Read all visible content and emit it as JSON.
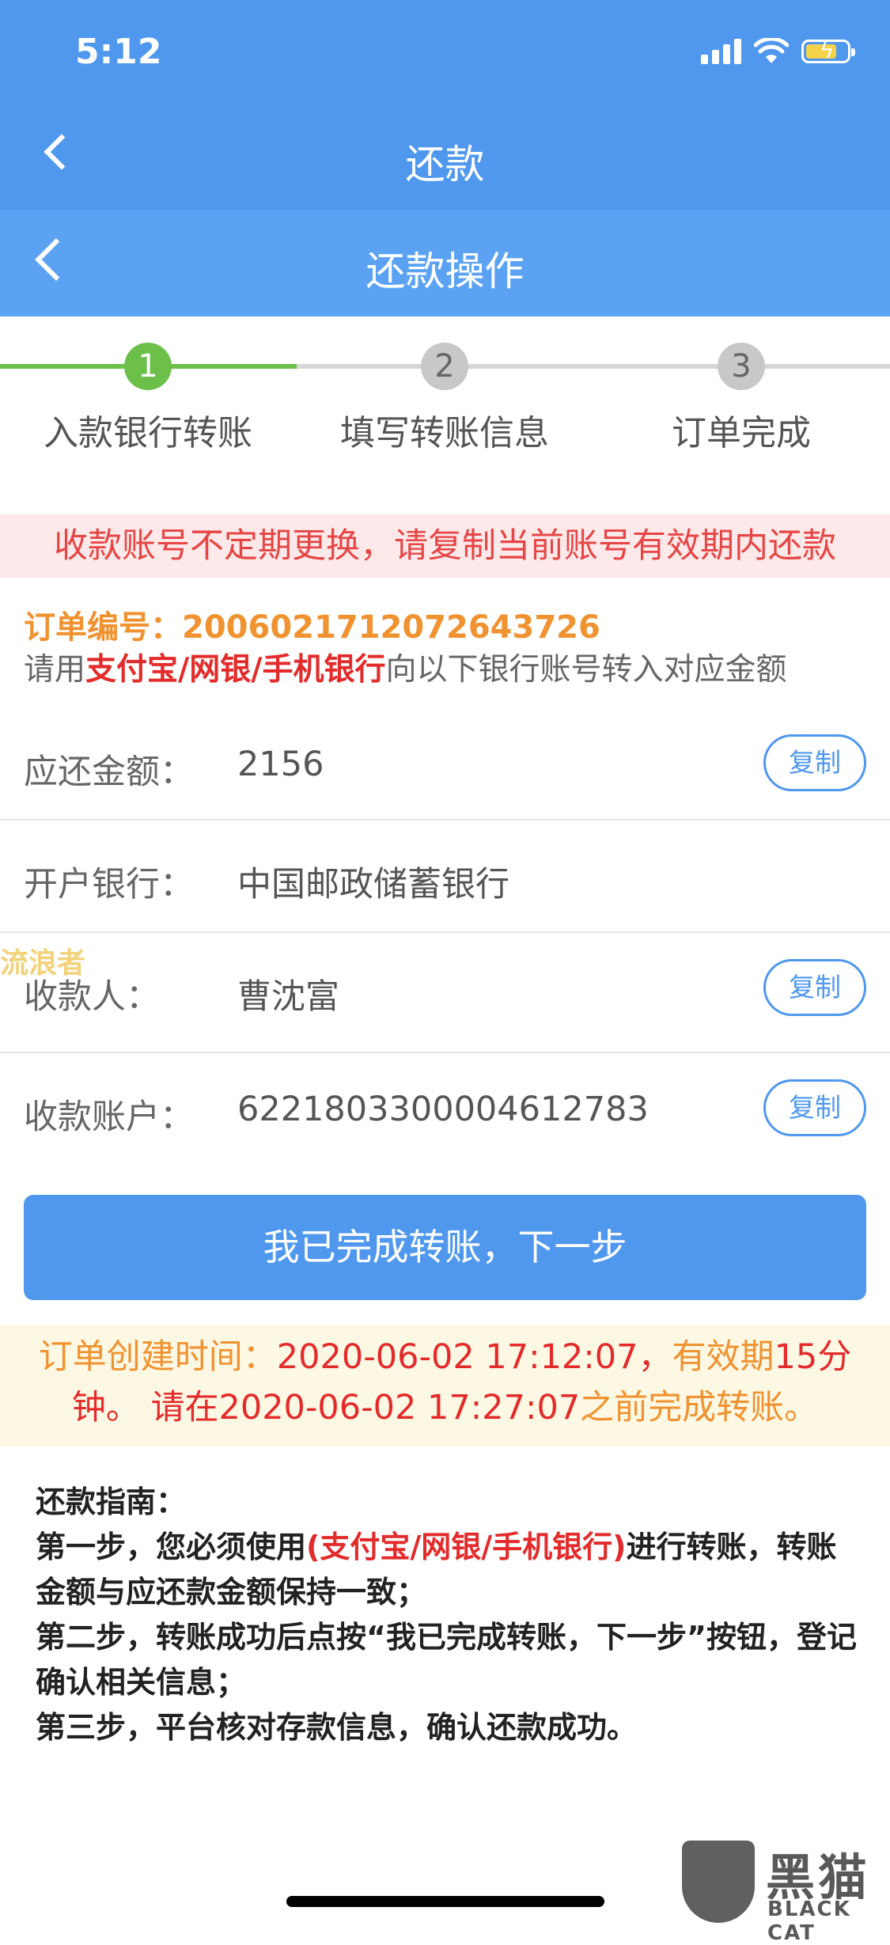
{
  "status_bar": {
    "time": "5:12"
  },
  "nav_primary": {
    "title": "还款"
  },
  "nav_secondary": {
    "title": "还款操作"
  },
  "steps": [
    {
      "num": "1",
      "label": "入款银行转账",
      "active": true
    },
    {
      "num": "2",
      "label": "填写转账信息",
      "active": false
    },
    {
      "num": "3",
      "label": "订单完成",
      "active": false
    }
  ],
  "warning_banner": "收款账号不定期更换，请复制当前账号有效期内还款",
  "order": {
    "label": "订单编号：",
    "number": "2006021712072643726"
  },
  "hint": {
    "prefix": "请用",
    "methods": "支付宝/网银/手机银行",
    "suffix": "向以下银行账号转入对应金额"
  },
  "fields": [
    {
      "key": "应还金额：",
      "value": "2156",
      "copy": "复制"
    },
    {
      "key": "开户银行：",
      "value": "中国邮政储蓄银行"
    },
    {
      "key": "收款人：",
      "value": "曹沈富",
      "copy": "复制"
    },
    {
      "key": "收款账户：",
      "value": "6221803300004612783",
      "copy": "复制"
    }
  ],
  "watermark_left": "流浪者",
  "primary_button": "我已完成转账，下一步",
  "time_notice": {
    "p1": "订单创建时间：",
    "created": "2020-06-02 17:12:07，",
    "p2": "有效期",
    "minutes": "15",
    "p3": "分",
    "p4": "钟。 请在",
    "deadline": "2020-06-02 17:27:07",
    "p5": "之前完成转账。"
  },
  "guide": {
    "title": "还款指南：",
    "step1_a": "第一步，您必须使用",
    "step1_methods": "(支付宝/网银/手机银行)",
    "step1_b": "进行转账，转账金额与应还款金额保持一致；",
    "step2": "第二步，转账成功后点按“我已完成转账，下一步”按钮，登记确认相关信息；",
    "step3": "第三步，平台核对存款信息，确认还款成功。"
  },
  "brand_watermark": {
    "cn": "黑猫",
    "en": "BLACK CAT"
  },
  "colors": {
    "nav_primary": "#4f98ee",
    "nav_secondary": "#5ba3f2",
    "step_active": "#6cc04a",
    "warning_text": "#e64545",
    "order_text": "#f0922f",
    "highlight_red": "#e32b2b"
  }
}
